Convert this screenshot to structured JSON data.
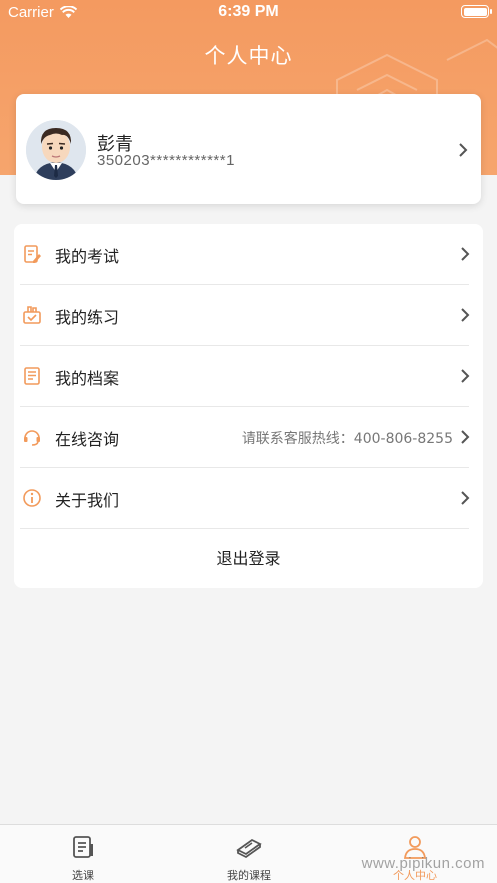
{
  "status_bar": {
    "carrier": "Carrier",
    "time": "6:39 PM"
  },
  "header": {
    "title": "个人中心"
  },
  "profile": {
    "name": "彭青",
    "id_number": "350203************1"
  },
  "menu": {
    "items": [
      {
        "label": "我的考试",
        "icon": "exam-edit-icon"
      },
      {
        "label": "我的练习",
        "icon": "practice-icon"
      },
      {
        "label": "我的档案",
        "icon": "document-icon"
      },
      {
        "label": "在线咨询",
        "icon": "headset-icon",
        "extra": "请联系客服热线：400-806-8255"
      },
      {
        "label": "关于我们",
        "icon": "info-icon"
      }
    ],
    "logout_label": "退出登录"
  },
  "tabbar": {
    "tabs": [
      {
        "label": "选课",
        "icon": "course-select-icon"
      },
      {
        "label": "我的课程",
        "icon": "my-courses-icon"
      },
      {
        "label": "个人中心",
        "icon": "profile-icon",
        "active": true
      }
    ]
  },
  "watermark": "www.pipikun.com",
  "colors": {
    "accent": "#f29a5b",
    "header": "#f49a60",
    "background": "#f4f4f4"
  }
}
